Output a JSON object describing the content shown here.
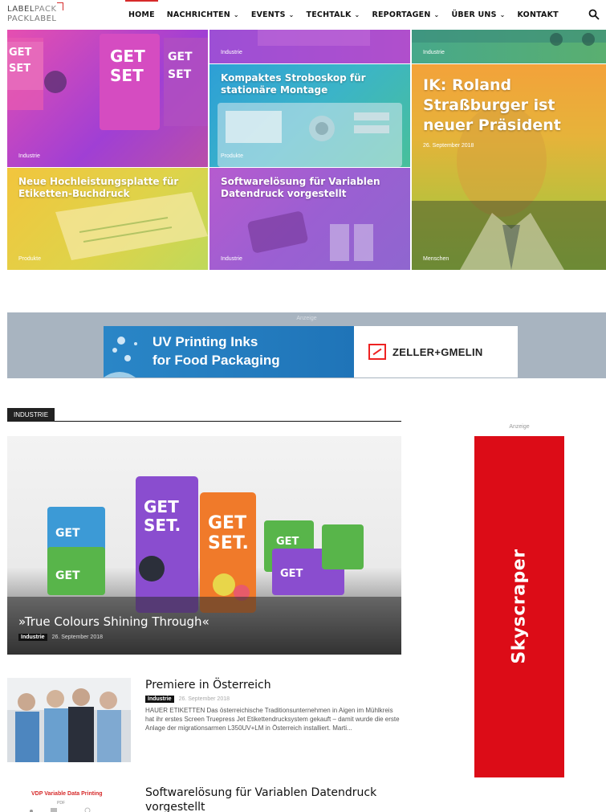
{
  "brand": {
    "line1a": "LABEL",
    "line1b": "PACK",
    "line2": "PACKLABEL"
  },
  "nav": [
    {
      "label": "HOME",
      "dropdown": false,
      "active": true
    },
    {
      "label": "NACHRICHTEN",
      "dropdown": true
    },
    {
      "label": "EVENTS",
      "dropdown": true
    },
    {
      "label": "TECHTALK",
      "dropdown": true
    },
    {
      "label": "REPORTAGEN",
      "dropdown": true
    },
    {
      "label": "ÜBER UNS",
      "dropdown": true
    },
    {
      "label": "KONTAKT",
      "dropdown": false
    }
  ],
  "hero": {
    "t1": {
      "category": "Industrie"
    },
    "t2": {
      "category": "Industrie"
    },
    "t3": {
      "category": "Industrie"
    },
    "t4": {
      "title": "Kompaktes Stroboskop für stationäre Montage",
      "category": "Produkte"
    },
    "t5": {
      "title": "IK: Roland Straßburger ist neuer Präsident",
      "date": "26. September 2018",
      "category": "Menschen"
    },
    "t6": {
      "title": "Neue Hochleistungsplatte für Etiketten-Buchdruck",
      "category": "Produkte"
    },
    "t7": {
      "title": "Softwarelösung für Variablen Datendruck vorgestellt",
      "category": "Industrie"
    }
  },
  "ad": {
    "label": "Anzeige",
    "line1": "UV Printing Inks",
    "line2": "for Food Packaging",
    "brand": "ZELLER+GMELIN"
  },
  "section": {
    "tag": "INDUSTRIE"
  },
  "featured": {
    "title": "»True Colours Shining Through«",
    "badge": "Industrie",
    "date": "26. September 2018",
    "package_text": "GET SET."
  },
  "skyscraper": {
    "label": "Anzeige",
    "text": "Skyscraper",
    "color": "#dc0c17"
  },
  "articles": [
    {
      "title": "Premiere in Österreich",
      "badge": "Industrie",
      "date": "26. September 2018",
      "excerpt": "HAUER ETIKETTEN     Das österreichische Traditionsunternehmen in Aigen im Mühlkreis hat ihr erstes Screen Truepress Jet Etikettendrucksystem gekauft – damit wurde die erste Anlage der migrationsarmen L350UV+LM in Österreich installiert. Marti..."
    },
    {
      "title": "Softwarelösung für Variablen Datendruck vorgestellt",
      "thumb_text": "VDP Variable Data Printing",
      "thumb_small": "PDF"
    }
  ],
  "colors": {
    "accent": "#d62a2a",
    "ad_band": "#a8b4c0",
    "ad_blue": "#1f74b8"
  }
}
